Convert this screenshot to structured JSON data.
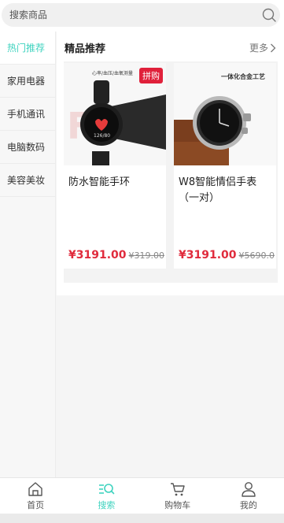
{
  "search": {
    "placeholder": "搜索商品"
  },
  "sidebar": {
    "items": [
      {
        "label": "热门推荐",
        "active": true
      },
      {
        "label": "家用电器",
        "active": false
      },
      {
        "label": "手机通讯",
        "active": false
      },
      {
        "label": "电脑数码",
        "active": false
      },
      {
        "label": "美容美妆",
        "active": false
      }
    ]
  },
  "section": {
    "title": "精品推荐",
    "more_label": "更多"
  },
  "products": [
    {
      "name": "防水智能手环",
      "price": "¥3191.00",
      "old_price": "¥319.00",
      "badge": "拼购",
      "image_caption": "心率/血压/血氧测量",
      "watch_screen_text": "126/80"
    },
    {
      "name": "W8智能情侣手表（一对）",
      "price": "¥3191.00",
      "old_price": "¥5690.0",
      "image_caption": "一体化合金工艺"
    }
  ],
  "tabbar": {
    "items": [
      {
        "label": "首页",
        "icon": "home-icon",
        "active": false
      },
      {
        "label": "搜索",
        "icon": "search-list-icon",
        "active": true
      },
      {
        "label": "购物车",
        "icon": "cart-icon",
        "active": false
      },
      {
        "label": "我的",
        "icon": "user-icon",
        "active": false
      }
    ]
  },
  "colors": {
    "accent": "#3fd3bf",
    "price": "#e02b3c",
    "badge": "#e0203a"
  }
}
